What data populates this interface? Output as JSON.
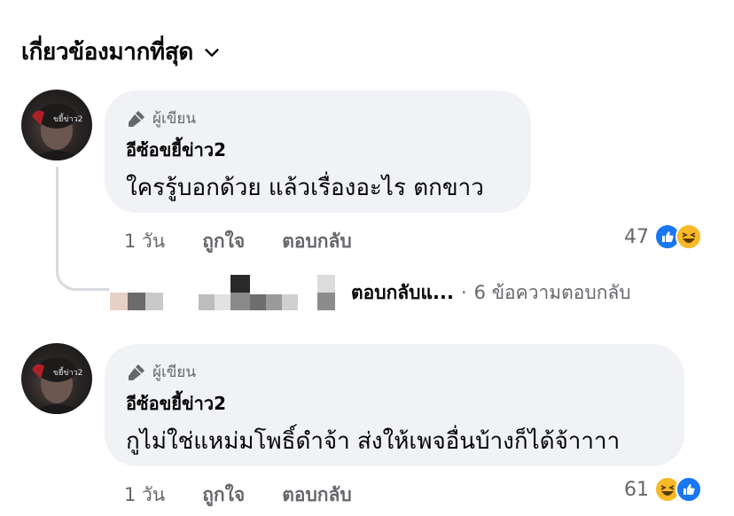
{
  "sort": {
    "label": "เกี่ยวข้องมากที่สุด",
    "icon": "chevron-down-icon"
  },
  "comments": [
    {
      "author_badge": "ผู้เขียน",
      "author_name": "อีซ้อขยี้ข่าว2",
      "text": "ใครรู้บอกด้วย แล้วเรื่องอะไร ตกขาว",
      "time": "1 วัน",
      "like_action": "ถูกใจ",
      "reply_action": "ตอบกลับ",
      "reaction_count": "47",
      "reactions": [
        "like",
        "haha"
      ]
    },
    {
      "author_badge": "ผู้เขียน",
      "author_name": "อีซ้อขยี้ข่าว2",
      "text": "กูไม่ใช่แหม่มโพธิ์ดำจ้า ส่งให้เพจอื่นบ้างก็ได้จ้าาาา",
      "time": "1 วัน",
      "like_action": "ถูกใจ",
      "reply_action": "ตอบกลับ",
      "reaction_count": "61",
      "reactions": [
        "haha",
        "like"
      ]
    }
  ],
  "replies_preview": {
    "summary": "ตอบกลับแ...",
    "separator": "·",
    "count_text": "6 ข้อความตอบกลับ"
  },
  "colors": {
    "like": "#1877f2",
    "haha": "#f7b928",
    "bubble": "#f0f2f5",
    "meta": "#65676b"
  }
}
